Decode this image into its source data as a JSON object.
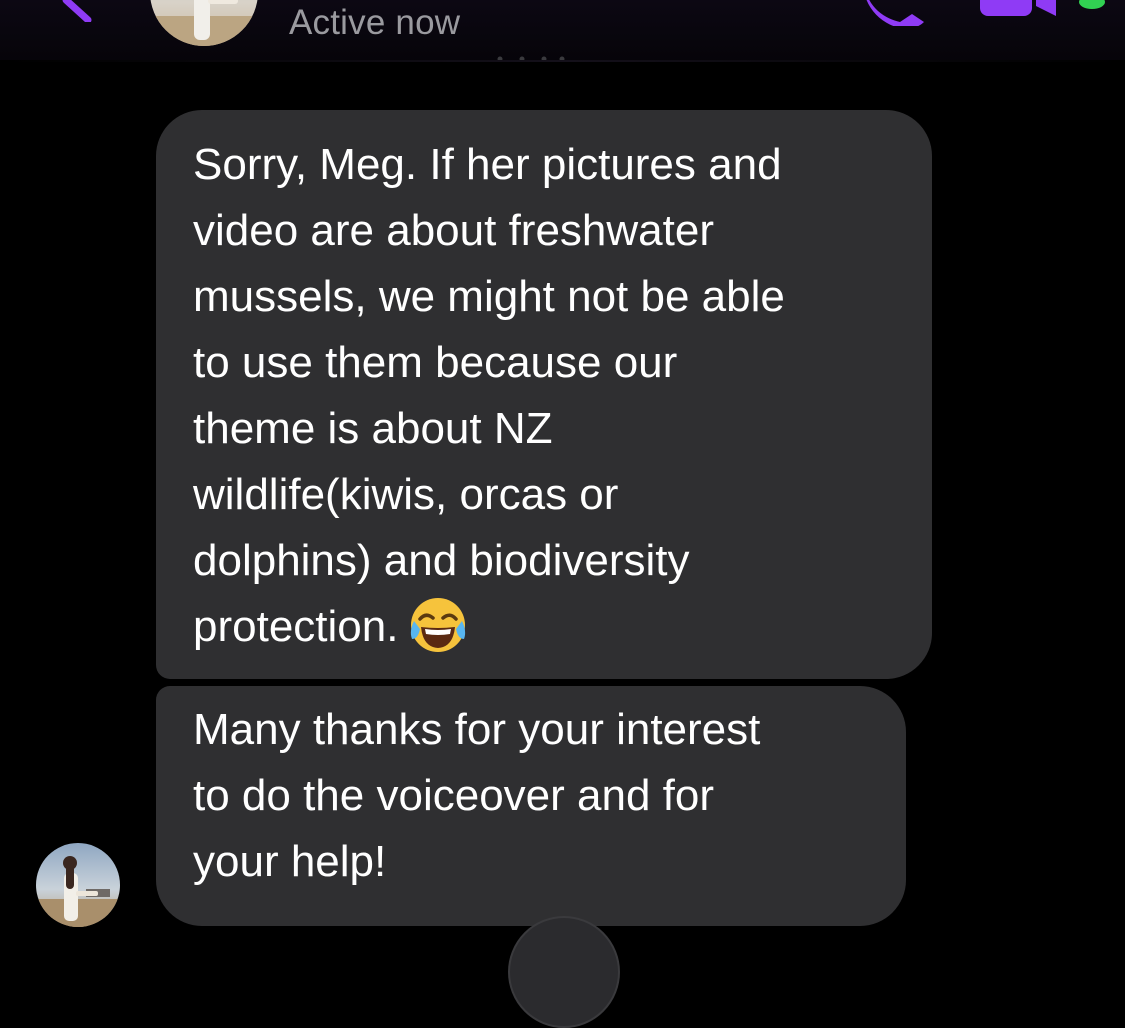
{
  "header": {
    "status": "Active now",
    "back_icon": "chevron-left-icon",
    "call_icon": "phone-icon",
    "video_icon": "video-camera-icon",
    "accent_color": "#8f3bf5",
    "online_color": "#31d152"
  },
  "messages": [
    {
      "lines": [
        "Sorry, Meg. If her pictures and",
        "video are about freshwater",
        "mussels, we might not be able",
        "to use them because our",
        "theme is about NZ",
        "wildlife(kiwis, orcas or",
        "dolphins) and biodiversity",
        "protection."
      ],
      "emoji": "tears-of-joy-emoji-icon"
    },
    {
      "lines": [
        "Many thanks for your interest",
        "to do the voiceover and for",
        "your help!"
      ]
    }
  ],
  "colors": {
    "background": "#000000",
    "bubble": "#2f2f31",
    "status_text": "#9a9a9f"
  }
}
